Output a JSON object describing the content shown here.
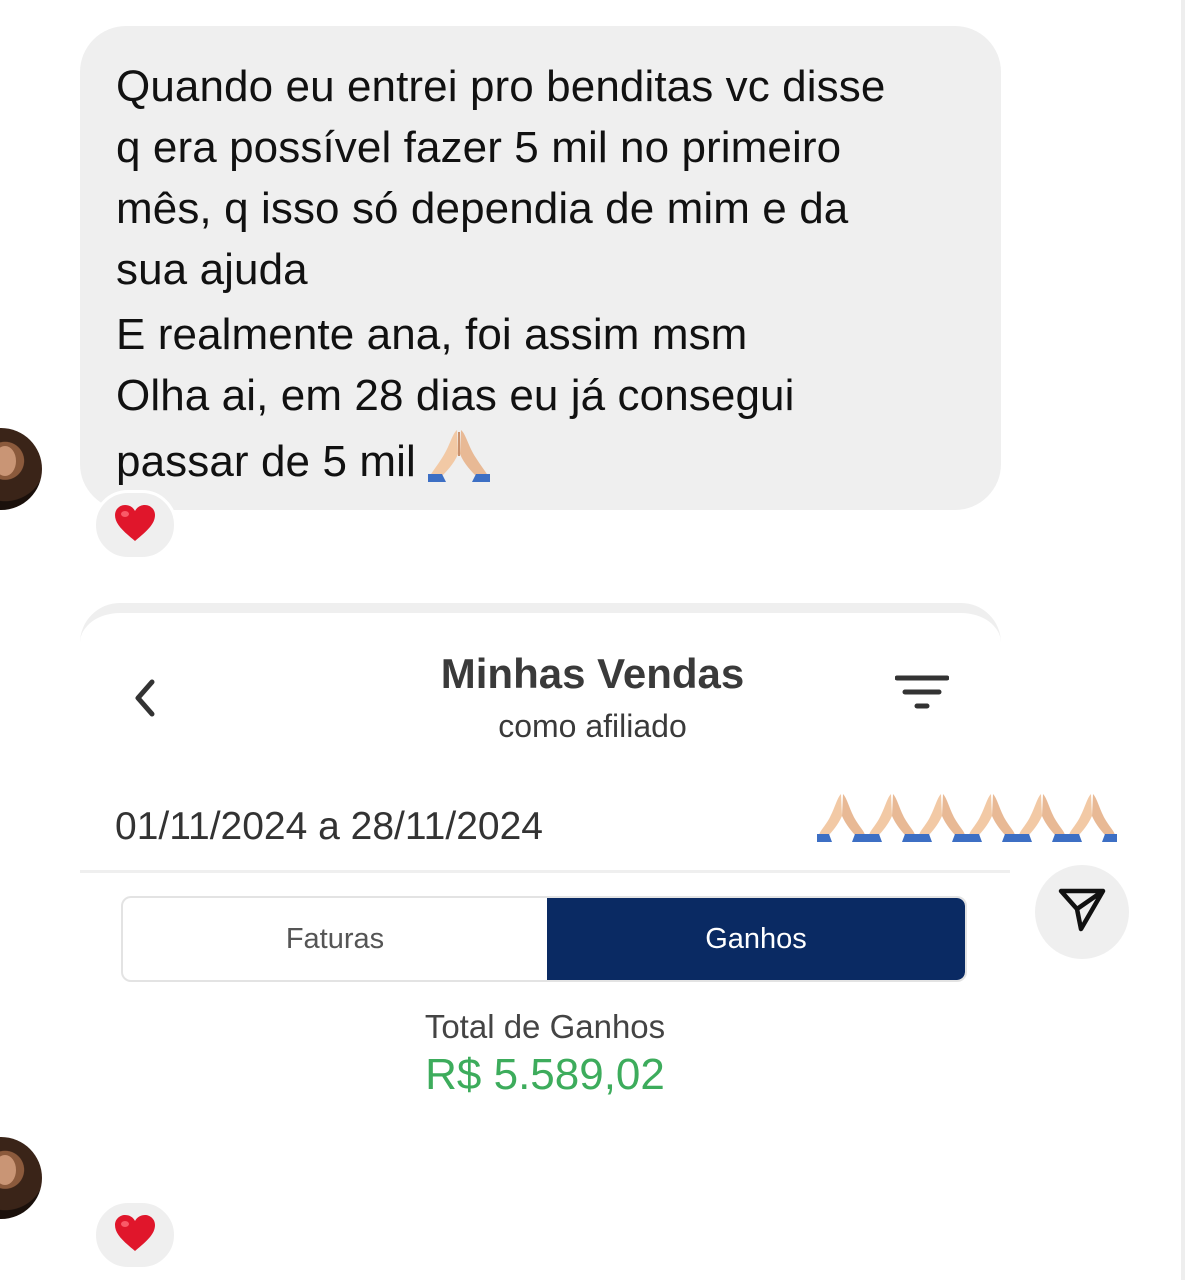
{
  "message": {
    "lines": [
      "Quando eu entrei pro benditas vc disse",
      "q era possível fazer 5 mil no primeiro",
      "mês, q isso só dependia de mim e da",
      "sua ajuda",
      "E realmente ana, foi assim msm",
      "Olha ai, em 28 dias eu já consegui",
      "passar de 5 mil"
    ],
    "reaction": "❤️"
  },
  "screenshot": {
    "title": "Minhas Vendas",
    "subtitle": "como afiliado",
    "date_range": "01/11/2024 a 28/11/2024",
    "tabs": {
      "left": "Faturas",
      "right": "Ganhos",
      "selected": "Ganhos"
    },
    "total_label": "Total de Ganhos",
    "total_value": "R$ 5.589,02",
    "value_color": "#3dac5c",
    "selected_tab_color": "#0a2a63"
  },
  "second_reaction": "❤️",
  "icons": {
    "back": "chevron-left-icon",
    "filter": "filter-icon",
    "share": "send-icon",
    "emoji": "praying-hands-icon"
  }
}
